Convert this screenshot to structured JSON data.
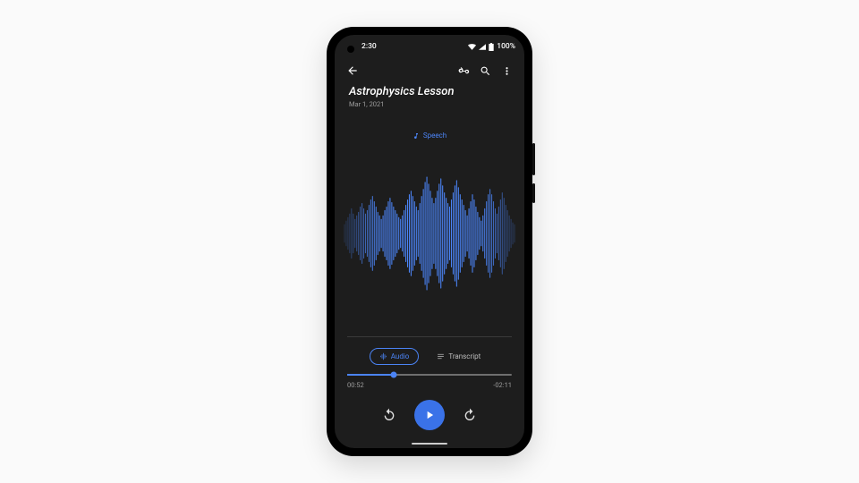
{
  "status_bar": {
    "time": "2:30",
    "battery_text": "100%"
  },
  "header": {
    "title": "Astrophysics Lesson",
    "date": "Mar 1, 2021"
  },
  "speech_label": "Speech",
  "tabs": {
    "audio": "Audio",
    "transcript": "Transcript"
  },
  "playback": {
    "elapsed": "00:52",
    "remaining": "-02:11",
    "progress_percent": 28
  },
  "colors": {
    "accent": "#4b84f6",
    "play": "#3a72e8"
  },
  "waveform": {
    "values": [
      10,
      14,
      18,
      22,
      28,
      22,
      16,
      20,
      24,
      30,
      34,
      28,
      22,
      26,
      32,
      38,
      42,
      36,
      30,
      24,
      20,
      16,
      20,
      26,
      30,
      36,
      40,
      35,
      30,
      26,
      22,
      18,
      16,
      20,
      26,
      32,
      38,
      44,
      48,
      42,
      36,
      30,
      26,
      34,
      42,
      50,
      58,
      64,
      56,
      48,
      40,
      34,
      40,
      48,
      56,
      62,
      54,
      46,
      40,
      34,
      30,
      38,
      46,
      54,
      60,
      52,
      44,
      38,
      32,
      26,
      20,
      28,
      36,
      44,
      38,
      30,
      24,
      18,
      14,
      20,
      28,
      36,
      44,
      50,
      44,
      36,
      28,
      22,
      30,
      38,
      46,
      40,
      32,
      26,
      20,
      16,
      12,
      10
    ]
  }
}
